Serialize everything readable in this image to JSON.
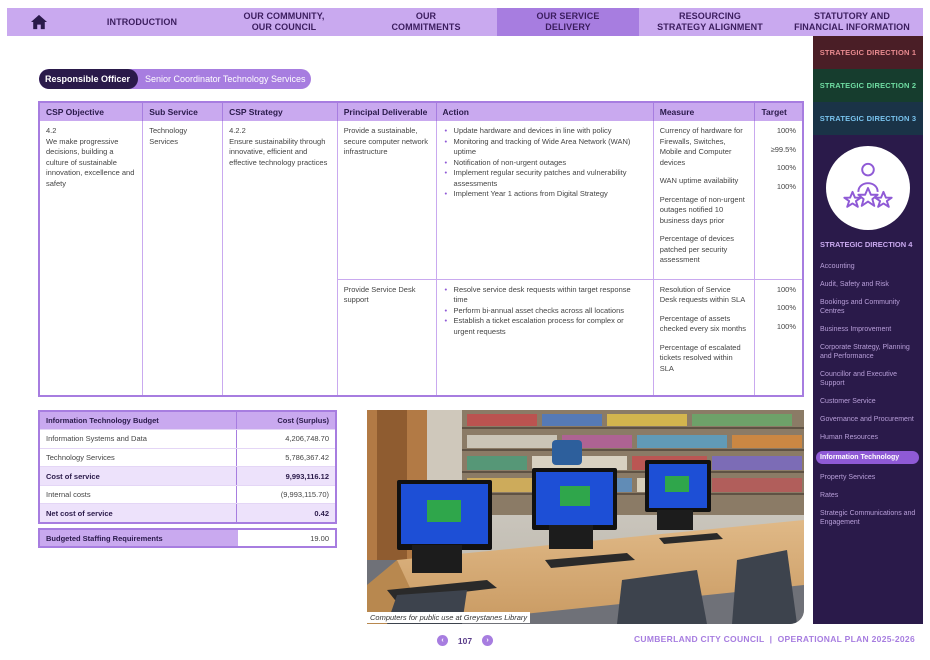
{
  "nav": {
    "home_icon": "home-icon",
    "items": [
      {
        "label": "INTRODUCTION",
        "active": false
      },
      {
        "label": "OUR COMMUNITY,\nOUR COUNCIL",
        "active": false
      },
      {
        "label": "OUR\nCOMMITMENTS",
        "active": false
      },
      {
        "label": "OUR SERVICE\nDELIVERY",
        "active": true
      },
      {
        "label": "RESOURCING\nSTRATEGY ALIGNMENT",
        "active": false
      },
      {
        "label": "STATUTORY AND\nFINANCIAL INFORMATION",
        "active": false
      }
    ]
  },
  "sidebar": {
    "directions": [
      "STRATEGIC DIRECTION 1",
      "STRATEGIC DIRECTION 2",
      "STRATEGIC DIRECTION 3"
    ],
    "icon": "people-stars-icon",
    "current_direction": "STRATEGIC DIRECTION 4",
    "items": [
      "Accounting",
      "Audit, Safety and Risk",
      "Bookings and Community Centres",
      "Business Improvement",
      "Corporate Strategy, Planning and Performance",
      "Councillor and Executive Support",
      "Customer Service",
      "Governance and Procurement",
      "Human Resources",
      "Information Technology",
      "Property Services",
      "Rates",
      "Strategic Communications and Engagement"
    ],
    "active_item": "Information Technology"
  },
  "officer": {
    "label": "Responsible Officer",
    "value": "Senior Coordinator Technology Services"
  },
  "table": {
    "headers": [
      "CSP Objective",
      "Sub Service",
      "CSP Strategy",
      "Principal Deliverable",
      "Action",
      "Measure",
      "Target"
    ],
    "csp_objective": "4.2\nWe make progressive decisions, building a culture of sustainable innovation, excellence and safety",
    "sub_service": "Technology Services",
    "csp_strategy": "4.2.2\nEnsure sustainability through innovative, efficient and effective technology practices",
    "deliverables": [
      {
        "title": "Provide a sustainable, secure computer network infrastructure",
        "actions": [
          "Update hardware and devices in line with policy",
          "Monitoring and tracking of Wide Area Network (WAN) uptime",
          "Notification of non-urgent outages",
          "Implement regular security patches and vulnerability assessments",
          "Implement Year 1 actions from Digital Strategy"
        ],
        "measures": [
          {
            "measure": "Currency of hardware for Firewalls, Switches, Mobile and Computer devices",
            "target": "100%"
          },
          {
            "measure": "WAN uptime availability",
            "target": "≥99.5%"
          },
          {
            "measure": "Percentage of non-urgent outages notified 10 business days prior",
            "target": "100%"
          },
          {
            "measure": "Percentage of devices patched per security assessment",
            "target": "100%"
          }
        ]
      },
      {
        "title": "Provide Service Desk support",
        "actions": [
          "Resolve service desk requests within target response time",
          "Perform bi-annual asset checks across all locations",
          "Establish a ticket escalation process for complex or urgent requests"
        ],
        "measures": [
          {
            "measure": "Resolution of Service Desk requests within SLA",
            "target": "100%"
          },
          {
            "measure": "Percentage of assets checked every six months",
            "target": "100%"
          },
          {
            "measure": "Percentage of escalated tickets resolved within SLA",
            "target": "100%"
          }
        ]
      }
    ]
  },
  "budget": {
    "header_label": "Information Technology Budget",
    "header_value": "Cost (Surplus)",
    "rows": [
      {
        "label": "Information Systems and Data",
        "value": "4,206,748.70",
        "bold": false
      },
      {
        "label": "Technology Services",
        "value": "5,786,367.42",
        "bold": false
      },
      {
        "label": "Cost of service",
        "value": "9,993,116.12",
        "bold": true
      },
      {
        "label": "Internal costs",
        "value": "(9,993,115.70)",
        "bold": false
      },
      {
        "label": "Net cost of service",
        "value": "0.42",
        "bold": true
      }
    ]
  },
  "staffing": {
    "label": "Budgeted Staffing Requirements",
    "value": "19.00"
  },
  "photo": {
    "caption": "Computers for public use at Greystanes Library"
  },
  "footer": {
    "page": "107",
    "prev_icon": "chevron-left-icon",
    "next_icon": "chevron-right-icon",
    "title": "CUMBERLAND CITY COUNCIL  |  OPERATIONAL PLAN 2025-2026"
  },
  "colors": {
    "nav_bg": "#c9a9ef",
    "nav_active": "#a77de0",
    "sidebar_bg": "#2a1a4a",
    "accent": "#8f5ad6"
  }
}
